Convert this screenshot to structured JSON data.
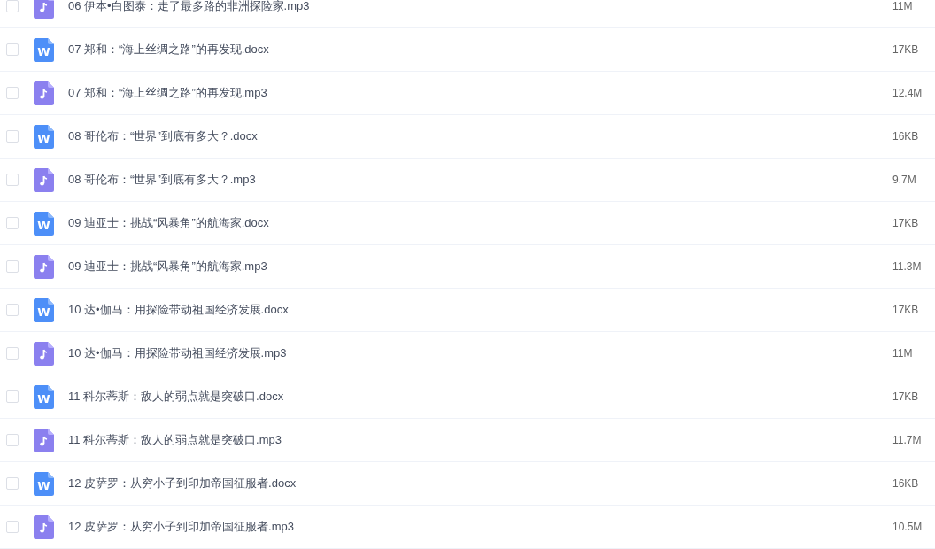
{
  "files": [
    {
      "kind": "audio",
      "name": "06 伊本•白图泰：走了最多路的非洲探险家.mp3",
      "size": "11M",
      "checked": false
    },
    {
      "kind": "document",
      "badge": "W",
      "name": "07 郑和：“海上丝绸之路”的再发现.docx",
      "size": "17KB",
      "checked": false
    },
    {
      "kind": "audio",
      "name": "07 郑和：“海上丝绸之路”的再发现.mp3",
      "size": "12.4M",
      "checked": false
    },
    {
      "kind": "document",
      "badge": "W",
      "name": "08 哥伦布：“世界”到底有多大？.docx",
      "size": "16KB",
      "checked": false
    },
    {
      "kind": "audio",
      "name": "08 哥伦布：“世界”到底有多大？.mp3",
      "size": "9.7M",
      "checked": false
    },
    {
      "kind": "document",
      "badge": "W",
      "name": "09 迪亚士：挑战“风暴角”的航海家.docx",
      "size": "17KB",
      "checked": false
    },
    {
      "kind": "audio",
      "name": "09 迪亚士：挑战“风暴角”的航海家.mp3",
      "size": "11.3M",
      "checked": false
    },
    {
      "kind": "document",
      "badge": "W",
      "name": "10 达•伽马：用探险带动祖国经济发展.docx",
      "size": "17KB",
      "checked": false
    },
    {
      "kind": "audio",
      "name": "10 达•伽马：用探险带动祖国经济发展.mp3",
      "size": "11M",
      "checked": false
    },
    {
      "kind": "document",
      "badge": "W",
      "name": "11 科尔蒂斯：敌人的弱点就是突破口.docx",
      "size": "17KB",
      "checked": false
    },
    {
      "kind": "audio",
      "name": "11 科尔蒂斯：敌人的弱点就是突破口.mp3",
      "size": "11.7M",
      "checked": false
    },
    {
      "kind": "document",
      "badge": "W",
      "name": "12 皮萨罗：从穷小子到印加帝国征服者.docx",
      "size": "16KB",
      "checked": false
    },
    {
      "kind": "audio",
      "name": "12 皮萨罗：从穷小子到印加帝国征服者.mp3",
      "size": "10.5M",
      "checked": false
    }
  ]
}
